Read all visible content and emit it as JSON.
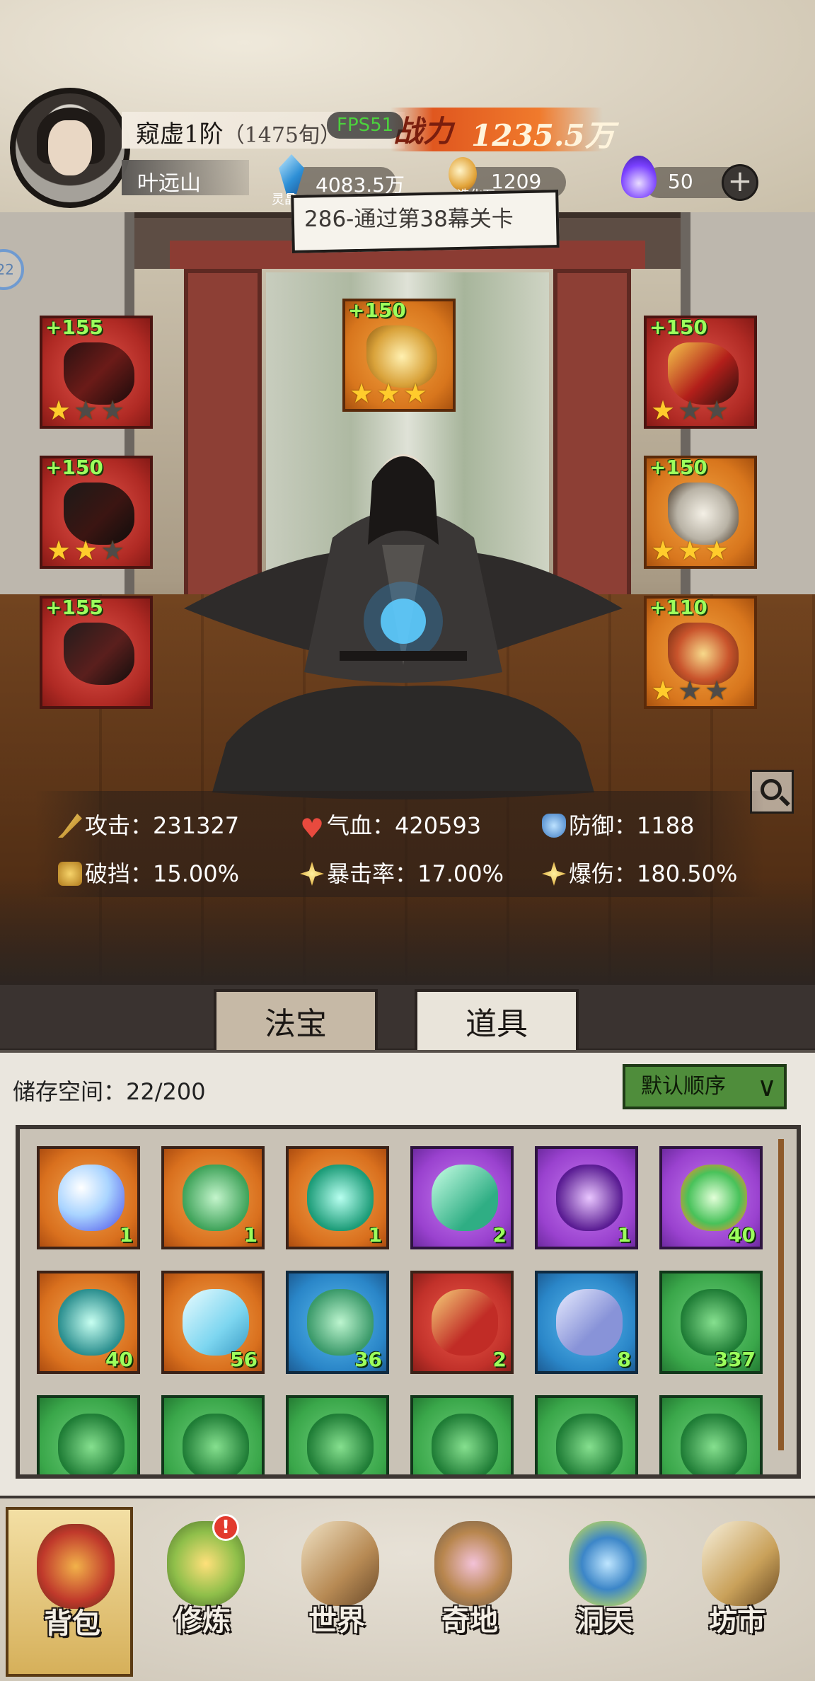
{
  "player": {
    "realm": "窥虚1阶",
    "realm_detail": "（1475旬）",
    "name": "叶远山"
  },
  "fps": "FPS51",
  "power": {
    "label": "战力",
    "value": "1235.5万"
  },
  "resources": [
    {
      "icon": "spirit-crystal-icon",
      "label": "灵晶",
      "value": "4083.5万"
    },
    {
      "icon": "creation-stone-icon",
      "label": "造化石",
      "value": "1209"
    },
    {
      "icon": "purple-flame-icon",
      "label": "",
      "value": "50"
    }
  ],
  "quest": "286-通过第38幕关卡",
  "side_badge": "22",
  "equipment": [
    {
      "slot": "weapon",
      "bonus": "+155",
      "stars": 1,
      "rarity": "red"
    },
    {
      "slot": "armor",
      "bonus": "+150",
      "stars": 2,
      "rarity": "red"
    },
    {
      "slot": "boots",
      "bonus": "+155",
      "stars": 0,
      "rarity": "red"
    },
    {
      "slot": "talisman",
      "bonus": "+150",
      "stars": 3,
      "rarity": "orange"
    },
    {
      "slot": "headband",
      "bonus": "+150",
      "stars": 1,
      "rarity": "red"
    },
    {
      "slot": "necklace",
      "bonus": "+150",
      "stars": 3,
      "rarity": "orange"
    },
    {
      "slot": "ring",
      "bonus": "+110",
      "stars": 1,
      "rarity": "orange"
    }
  ],
  "stats": {
    "attack": "攻击：231327",
    "hp": "气血：420593",
    "defense": "防御：1188",
    "break": "破挡：15.00%",
    "crit_rate": "暴击率：17.00%",
    "crit_dmg": "爆伤：180.50%"
  },
  "tabs": {
    "treasures": "法宝",
    "items": "道具"
  },
  "storage": {
    "label": "储存空间：22/200",
    "sort": "默认顺序",
    "items": [
      {
        "rarity": "orange",
        "icon": "crystal-orb-icon",
        "count": "1"
      },
      {
        "rarity": "orange",
        "icon": "jade-leaf-icon",
        "count": "1"
      },
      {
        "rarity": "orange",
        "icon": "jade-swirl-icon",
        "count": "1"
      },
      {
        "rarity": "purple",
        "icon": "jade-shard-icon",
        "count": "2"
      },
      {
        "rarity": "purple",
        "icon": "violet-flower-icon",
        "count": "1"
      },
      {
        "rarity": "purple",
        "icon": "lightning-orb-icon",
        "count": "40"
      },
      {
        "rarity": "orange",
        "icon": "wind-swirl-icon",
        "count": "40"
      },
      {
        "rarity": "orange",
        "icon": "ice-crystal-icon",
        "count": "56"
      },
      {
        "rarity": "blue",
        "icon": "jade-beast-icon",
        "count": "36"
      },
      {
        "rarity": "red",
        "icon": "red-talisman-icon",
        "count": "2"
      },
      {
        "rarity": "blue",
        "icon": "silver-token-icon",
        "count": "8"
      },
      {
        "rarity": "green",
        "icon": "green-gem-icon",
        "count": "337"
      },
      {
        "rarity": "green",
        "icon": "green-gem-icon",
        "count": ""
      },
      {
        "rarity": "green",
        "icon": "green-gem-icon",
        "count": ""
      },
      {
        "rarity": "green",
        "icon": "green-gem-icon",
        "count": ""
      },
      {
        "rarity": "green",
        "icon": "green-gem-icon",
        "count": ""
      },
      {
        "rarity": "green",
        "icon": "green-gem-icon",
        "count": ""
      },
      {
        "rarity": "green",
        "icon": "green-gem-icon",
        "count": ""
      }
    ]
  },
  "nav": [
    {
      "label": "背包",
      "icon": "backpack-icon",
      "selected": true
    },
    {
      "label": "修炼",
      "icon": "cultivation-flower-icon",
      "alert": "!"
    },
    {
      "label": "世界",
      "icon": "world-scroll-icon"
    },
    {
      "label": "奇地",
      "icon": "pagoda-island-icon"
    },
    {
      "label": "洞天",
      "icon": "portal-icon"
    },
    {
      "label": "坊市",
      "icon": "market-stall-icon"
    }
  ]
}
